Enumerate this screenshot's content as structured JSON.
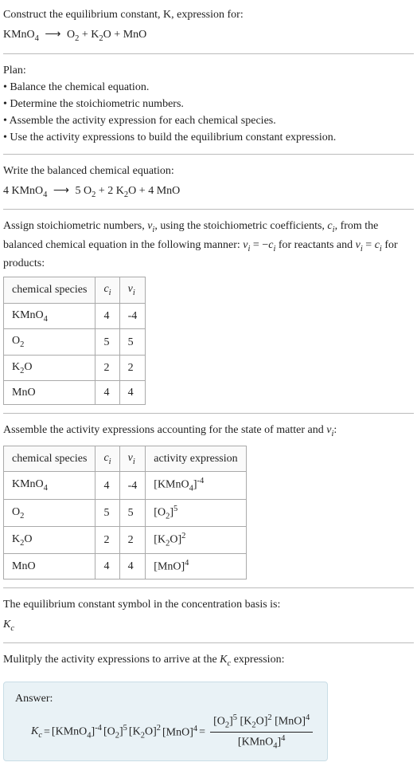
{
  "prompt": {
    "line1": "Construct the equilibrium constant, K, expression for:",
    "unbalanced_left": "KMnO",
    "unbalanced_right_o2": "O",
    "unbalanced_right_k2o": "K",
    "unbalanced_right_mno": "MnO",
    "arrow": "⟶"
  },
  "plan": {
    "heading": "Plan:",
    "items": [
      "• Balance the chemical equation.",
      "• Determine the stoichiometric numbers.",
      "• Assemble the activity expression for each chemical species.",
      "• Use the activity expressions to build the equilibrium constant expression."
    ]
  },
  "balanced": {
    "heading": "Write the balanced chemical equation:",
    "c_kmno4": "4",
    "c_o2": "5",
    "c_k2o": "2",
    "c_mno": "4",
    "sp_kmno4": "KMnO",
    "sp_o2": "O",
    "sp_k2o": "K",
    "sp_mno": "MnO",
    "arrow": "⟶"
  },
  "stoich": {
    "heading_pre": "Assign stoichiometric numbers, ",
    "heading_mid1": ", using the stoichiometric coefficients, ",
    "heading_mid2": ", from the balanced chemical equation in the following manner: ",
    "heading_reactants": " for reactants and ",
    "heading_products": " for products:",
    "nu": "ν",
    "c": "c",
    "sub_i": "i",
    "eq_minus": " = −",
    "eq_pos": " = ",
    "table_headers": [
      "chemical species",
      "cᵢ",
      "νᵢ"
    ],
    "rows": [
      {
        "species_base": "KMnO",
        "species_sub": "4",
        "c": "4",
        "nu": "-4"
      },
      {
        "species_base": "O",
        "species_sub": "2",
        "c": "5",
        "nu": "5"
      },
      {
        "species_base": "K",
        "species_sub": "2",
        "species_tail": "O",
        "c": "2",
        "nu": "2"
      },
      {
        "species_base": "MnO",
        "species_sub": "",
        "c": "4",
        "nu": "4"
      }
    ]
  },
  "activity": {
    "heading_pre": "Assemble the activity expressions accounting for the state of matter and ",
    "heading_post": ":",
    "table_headers": [
      "chemical species",
      "cᵢ",
      "νᵢ",
      "activity expression"
    ],
    "rows": [
      {
        "species_base": "KMnO",
        "species_sub": "4",
        "c": "4",
        "nu": "-4",
        "act_inner_base": "KMnO",
        "act_inner_sub": "4",
        "act_exp": "-4"
      },
      {
        "species_base": "O",
        "species_sub": "2",
        "c": "5",
        "nu": "5",
        "act_inner_base": "O",
        "act_inner_sub": "2",
        "act_exp": "5"
      },
      {
        "species_base": "K",
        "species_sub": "2",
        "species_tail": "O",
        "c": "2",
        "nu": "2",
        "act_inner_base": "K",
        "act_inner_sub": "2",
        "act_inner_tail": "O",
        "act_exp": "2"
      },
      {
        "species_base": "MnO",
        "species_sub": "",
        "c": "4",
        "nu": "4",
        "act_inner_base": "MnO",
        "act_inner_sub": "",
        "act_exp": "4"
      }
    ]
  },
  "kc_symbol": {
    "heading": "The equilibrium constant symbol in the concentration basis is:",
    "K": "K",
    "sub": "c"
  },
  "multiply": {
    "heading_pre": "Mulitply the activity expressions to arrive at the ",
    "heading_post": " expression:"
  },
  "answer": {
    "label": "Answer:",
    "K": "K",
    "sub_c": "c",
    "eq": " = ",
    "terms": [
      {
        "base": "KMnO",
        "sub": "4",
        "exp": "-4"
      },
      {
        "base": "O",
        "sub": "2",
        "exp": "5"
      },
      {
        "base": "K",
        "sub": "2",
        "tail": "O",
        "exp": "2"
      },
      {
        "base": "MnO",
        "sub": "",
        "exp": "4"
      }
    ],
    "frac_num": [
      {
        "base": "O",
        "sub": "2",
        "exp": "5"
      },
      {
        "base": "K",
        "sub": "2",
        "tail": "O",
        "exp": "2"
      },
      {
        "base": "MnO",
        "sub": "",
        "exp": "4"
      }
    ],
    "frac_den": [
      {
        "base": "KMnO",
        "sub": "4",
        "exp": "4"
      }
    ]
  }
}
